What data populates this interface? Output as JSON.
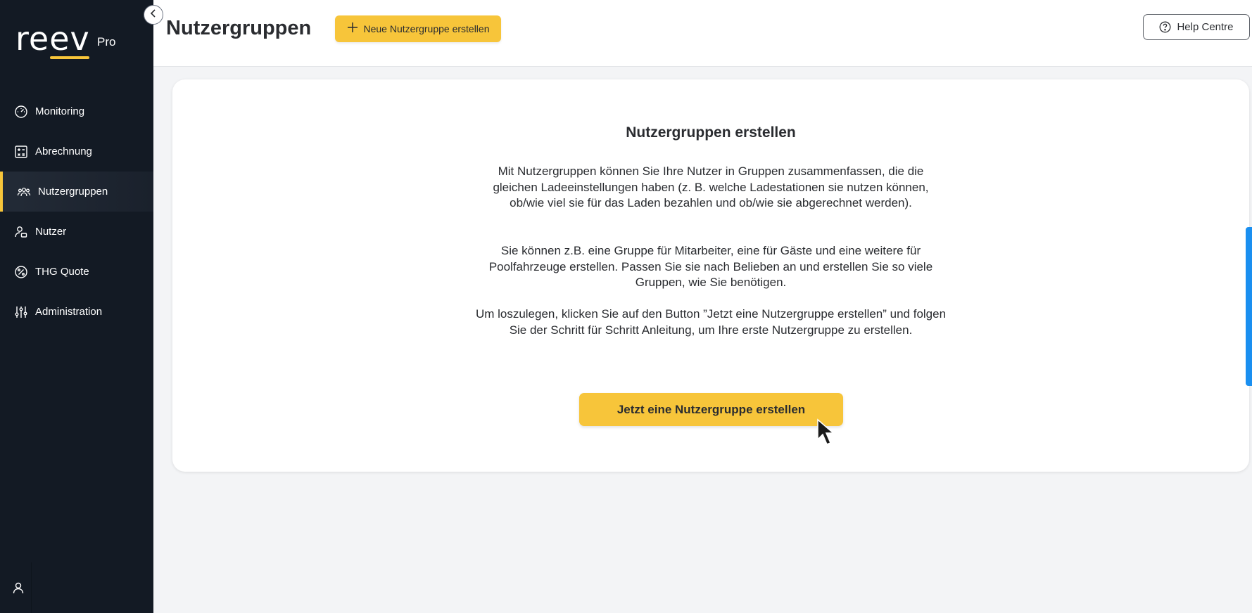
{
  "brand": {
    "logo_text": "reev",
    "logo_sub": "Pro",
    "accent": "#f7c53a",
    "sidebar_bg": "#131a24"
  },
  "sidebar": {
    "items": [
      {
        "label": "Monitoring",
        "icon": "speedometer-icon",
        "active": false
      },
      {
        "label": "Abrechnung",
        "icon": "calculator-icon",
        "active": false
      },
      {
        "label": "Nutzergruppen",
        "icon": "user-group-icon",
        "active": true
      },
      {
        "label": "Nutzer",
        "icon": "user-icon",
        "active": false
      },
      {
        "label": "THG Quote",
        "icon": "percent-icon",
        "active": false
      },
      {
        "label": "Administration",
        "icon": "sliders-icon",
        "active": false
      }
    ],
    "footer_icon": "user-icon"
  },
  "header": {
    "title": "Nutzergruppen",
    "new_button_label": "Neue Nutzergruppe erstellen",
    "help_label": "Help Centre"
  },
  "main": {
    "heading": "Nutzergruppen erstellen",
    "paragraph_1": "Mit Nutzergruppen können Sie Ihre Nutzer in Gruppen zusammenfassen, die die gleichen Ladeeinstellungen haben (z. B. welche Ladestationen sie nutzen können, ob/wie viel sie für das Laden bezahlen und ob/wie sie abgerechnet werden).",
    "paragraph_2": "Sie können z.B. eine Gruppe für Mitarbeiter, eine für Gäste und eine weitere für Poolfahrzeuge erstellen. Passen Sie sie nach Belieben an und erstellen Sie so viele Gruppen, wie Sie benötigen.",
    "paragraph_3": "Um loszulegen, klicken Sie auf den Button ”Jetzt eine Nutzergruppe erstellen” und folgen Sie der Schritt für Schritt Anleitung, um Ihre erste Nutzergruppe zu erstellen.",
    "cta_label": "Jetzt eine Nutzergruppe erstellen"
  }
}
